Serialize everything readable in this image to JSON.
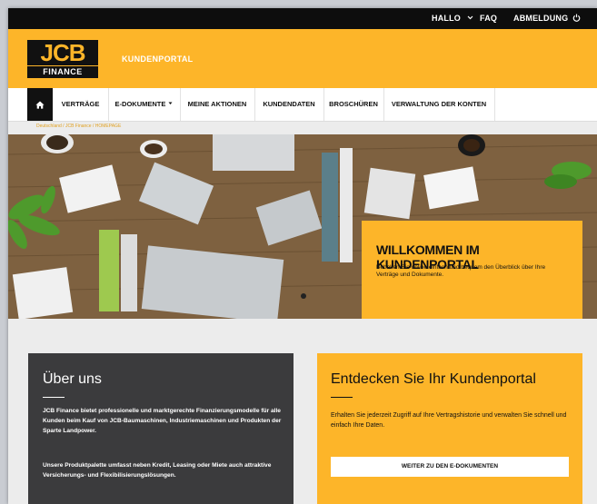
{
  "topbar": {
    "hallo": "HALLO",
    "faq": "FAQ",
    "logout": "ABMELDUNG"
  },
  "header": {
    "logo_top": "JCB",
    "logo_bottom": "FINANCE",
    "portal": "KUNDENPORTAL"
  },
  "nav": {
    "items": [
      "VERTRÄGE",
      "E-DOKUMENTE",
      "MEINE AKTIONEN",
      "KUNDENDATEN",
      "BROSCHÜREN",
      "VERWALTUNG DER KONTEN"
    ]
  },
  "breadcrumb": {
    "text": "Deutschland / JCB Finance / HOMEPAGE"
  },
  "hero": {
    "title": "WILLKOMMEN IM KUNDENPORTAL",
    "desc": "Behalten Sie online einfach und bequem den Überblick über Ihre Verträge und Dokumente."
  },
  "about": {
    "title": "Über uns",
    "p1": "JCB Finance bietet professionelle und marktgerechte Finanzierungsmodelle für alle Kunden beim Kauf von JCB-Baumaschinen, Industriemaschinen und Produkten der Sparte Landpower.",
    "p2": "Unsere Produktpalette umfasst neben Kredit, Leasing oder Miete auch attraktive Versicherungs- und Flexibilisierungslösungen."
  },
  "discover": {
    "title": "Entdecken Sie Ihr Kundenportal",
    "p": "Erhalten Sie jederzeit Zugriff auf Ihre Vertragshistorie und verwalten Sie schnell und einfach Ihre Daten.",
    "button": "WEITER ZU DEN E-DOKUMENTEN"
  },
  "colors": {
    "brand_yellow": "#fdb529",
    "topbar": "#0d0d0d",
    "dark_panel": "#3b3b3d"
  },
  "icons": [
    "chevron-down-icon",
    "power-icon",
    "home-icon"
  ]
}
